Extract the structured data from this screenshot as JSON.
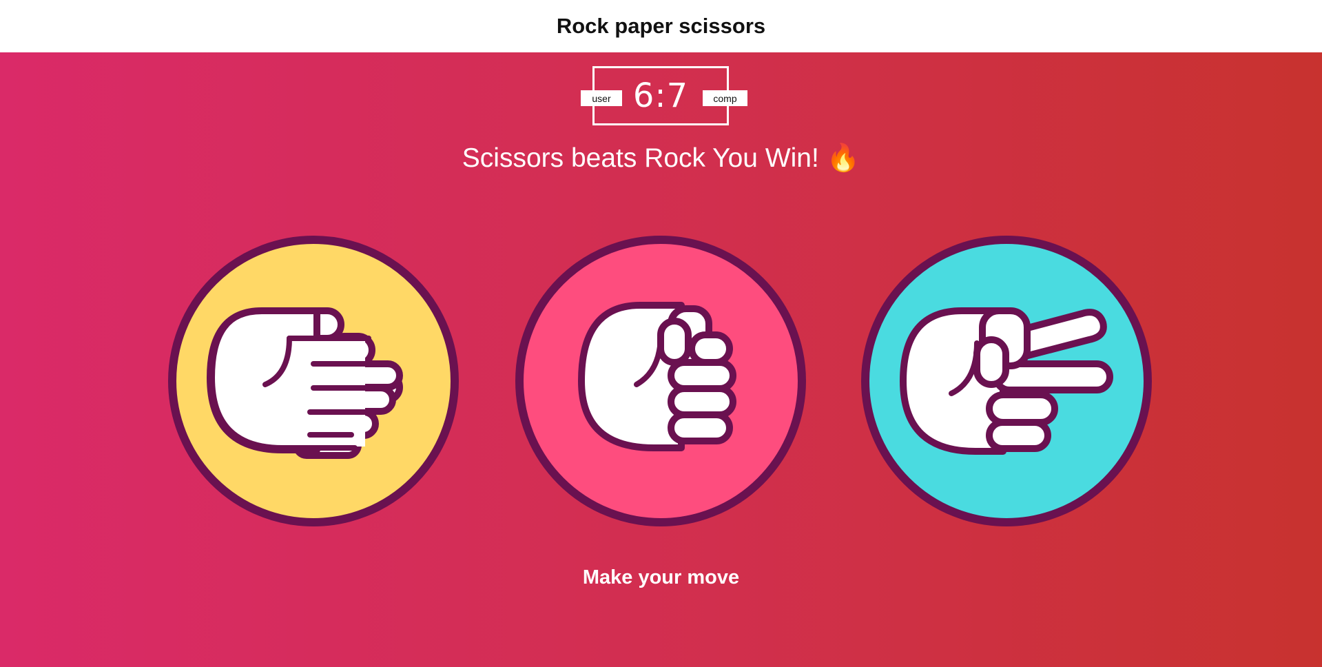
{
  "header": {
    "title": "Rock paper scissors"
  },
  "scoreboard": {
    "user_label": "user",
    "comp_label": "comp",
    "score": "6:7"
  },
  "result": {
    "message": "Scissors beats Rock You Win! 🔥"
  },
  "choices": [
    {
      "id": "paper",
      "icon": "paper-hand-icon",
      "color": "#ffd866"
    },
    {
      "id": "rock",
      "icon": "rock-fist-icon",
      "color": "#fe4d7e"
    },
    {
      "id": "scissors",
      "icon": "scissors-hand-icon",
      "color": "#4adbe0"
    }
  ],
  "prompt": {
    "text": "Make your move"
  },
  "colors": {
    "outline": "#6a1150",
    "background_start": "#da2a68",
    "background_end": "#c8322f"
  }
}
